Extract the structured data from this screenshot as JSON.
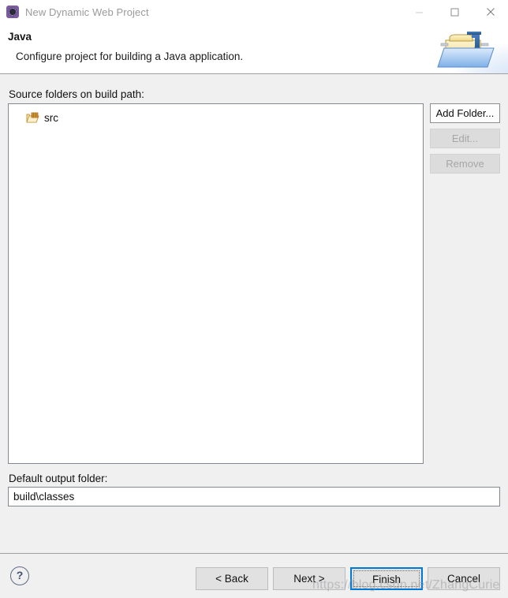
{
  "window": {
    "title": "New Dynamic Web Project",
    "icon": "eclipse-wizard-icon",
    "controls": {
      "minimize": "minimize-icon",
      "maximize": "maximize-icon",
      "close": "close-icon"
    }
  },
  "header": {
    "title": "Java",
    "description": "Configure project for building a Java application.",
    "banner_icon": "java-folder-banner-icon"
  },
  "main": {
    "source_folders_label": "Source folders on build path:",
    "source_folders": [
      {
        "name": "src",
        "icon": "source-folder-icon"
      }
    ],
    "side_buttons": [
      {
        "label": "Add Folder...",
        "name": "add-folder-button",
        "enabled": true
      },
      {
        "label": "Edit...",
        "name": "edit-button",
        "enabled": false
      },
      {
        "label": "Remove",
        "name": "remove-button",
        "enabled": false
      }
    ],
    "output_folder_label": "Default output folder:",
    "output_folder_value": "build\\classes",
    "output_folder_placeholder": ""
  },
  "footer": {
    "help_icon": "help-question-icon",
    "buttons": [
      {
        "label": "< Back",
        "name": "back-button",
        "default": false
      },
      {
        "label": "Next >",
        "name": "next-button",
        "default": false
      },
      {
        "label": "Finish",
        "name": "finish-button",
        "default": true
      },
      {
        "label": "Cancel",
        "name": "cancel-button",
        "default": false
      }
    ]
  },
  "watermark": {
    "text": "https://blog.csdn.net/ZhangCurie"
  },
  "colors": {
    "dialog_background": "#f0f0f0",
    "accent": "#0078d7",
    "field_background": "#ffffff",
    "border": "#828790",
    "disabled_text": "#a6a6a6"
  }
}
